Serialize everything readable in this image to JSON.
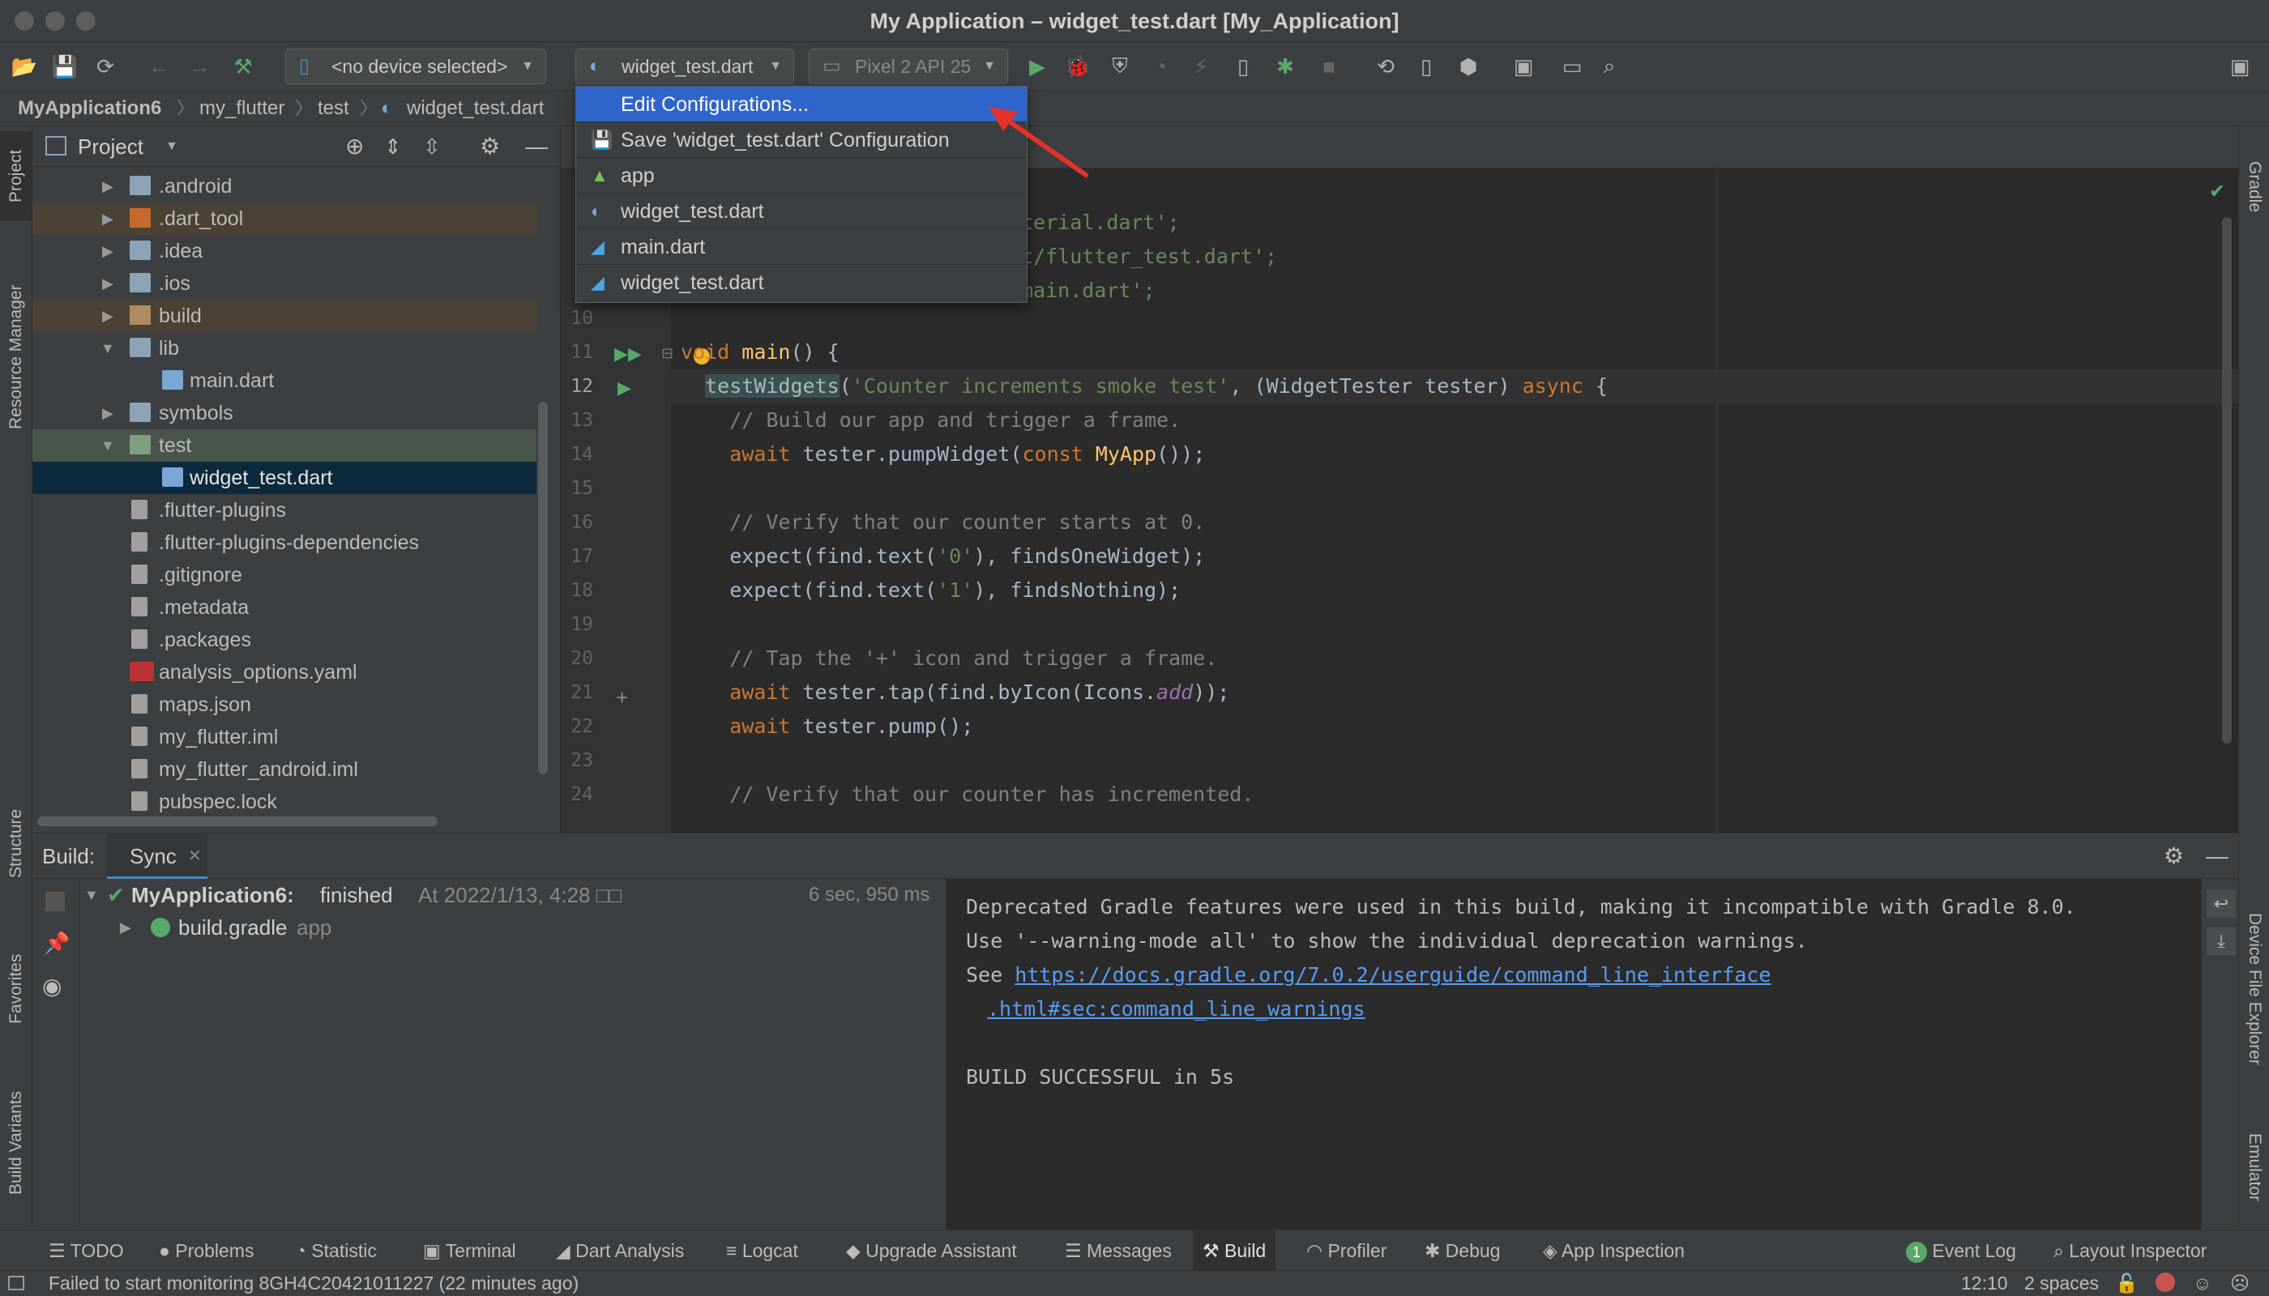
{
  "window": {
    "title": "My Application – widget_test.dart [My_Application]"
  },
  "toolbar": {
    "device_combo": "<no device selected>",
    "config_combo": "widget_test.dart",
    "emulator_combo": "Pixel 2 API 25"
  },
  "breadcrumb": [
    "MyApplication6",
    "my_flutter",
    "test",
    "widget_test.dart"
  ],
  "project_panel": {
    "title": "Project",
    "items": [
      {
        "label": ".android",
        "type": "folder",
        "depth": 1,
        "expanded": false
      },
      {
        "label": ".dart_tool",
        "type": "folder-orange",
        "depth": 1,
        "expanded": false
      },
      {
        "label": ".idea",
        "type": "folder",
        "depth": 1,
        "expanded": false
      },
      {
        "label": ".ios",
        "type": "folder",
        "depth": 1,
        "expanded": false
      },
      {
        "label": "build",
        "type": "folder-orange",
        "depth": 1,
        "expanded": false
      },
      {
        "label": "lib",
        "type": "folder",
        "depth": 1,
        "expanded": true
      },
      {
        "label": "main.dart",
        "type": "dart",
        "depth": 2
      },
      {
        "label": "symbols",
        "type": "folder",
        "depth": 1,
        "expanded": false
      },
      {
        "label": "test",
        "type": "folder-test",
        "depth": 1,
        "expanded": true
      },
      {
        "label": "widget_test.dart",
        "type": "dart",
        "depth": 2,
        "selected": true
      },
      {
        "label": ".flutter-plugins",
        "type": "file",
        "depth": 1
      },
      {
        "label": ".flutter-plugins-dependencies",
        "type": "file",
        "depth": 1
      },
      {
        "label": ".gitignore",
        "type": "file",
        "depth": 1
      },
      {
        "label": ".metadata",
        "type": "file",
        "depth": 1
      },
      {
        "label": ".packages",
        "type": "file",
        "depth": 1
      },
      {
        "label": "analysis_options.yaml",
        "type": "yaml",
        "depth": 1
      },
      {
        "label": "maps.json",
        "type": "file",
        "depth": 1
      },
      {
        "label": "my_flutter.iml",
        "type": "file",
        "depth": 1
      },
      {
        "label": "my_flutter_android.iml",
        "type": "file",
        "depth": 1
      },
      {
        "label": "pubspec.lock",
        "type": "file",
        "depth": 1
      }
    ]
  },
  "config_popup": {
    "items": [
      {
        "label": "Edit Configurations...",
        "icon": "none",
        "highlighted": true
      },
      {
        "label": "Save 'widget_test.dart' Configuration",
        "icon": "save-icon"
      },
      {
        "label": "app",
        "icon": "android-icon"
      },
      {
        "label": "widget_test.dart",
        "icon": "flutter-test-icon"
      },
      {
        "label": "main.dart",
        "icon": "flutter-icon"
      },
      {
        "label": "widget_test.dart",
        "icon": "flutter-icon"
      }
    ]
  },
  "editor": {
    "partial_lines": [
      {
        "text": "terial.dart';"
      },
      {
        "text": "t/flutter_test.dart';"
      },
      {
        "text": "main.dart';"
      }
    ],
    "lines": [
      {
        "num": "10",
        "text": ""
      },
      {
        "num": "11",
        "text": "void main() {"
      },
      {
        "num": "12",
        "text": "  testWidgets('Counter increments smoke test', (WidgetTester tester) async {"
      },
      {
        "num": "13",
        "text": "    // Build our app and trigger a frame."
      },
      {
        "num": "14",
        "text": "    await tester.pumpWidget(const MyApp());"
      },
      {
        "num": "15",
        "text": ""
      },
      {
        "num": "16",
        "text": "    // Verify that our counter starts at 0."
      },
      {
        "num": "17",
        "text": "    expect(find.text('0'), findsOneWidget);"
      },
      {
        "num": "18",
        "text": "    expect(find.text('1'), findsNothing);"
      },
      {
        "num": "19",
        "text": ""
      },
      {
        "num": "20",
        "text": "    // Tap the '+' icon and trigger a frame."
      },
      {
        "num": "21",
        "text": "    await tester.tap(find.byIcon(Icons.add));"
      },
      {
        "num": "22",
        "text": "    await tester.pump();"
      },
      {
        "num": "23",
        "text": ""
      },
      {
        "num": "24",
        "text": "    // Verify that our counter has incremented."
      }
    ]
  },
  "build_panel": {
    "label": "Build:",
    "tab": "Sync",
    "root_name": "MyApplication6:",
    "root_status": "finished",
    "root_time": "At 2022/1/13, 4:28 □□",
    "duration": "6 sec, 950 ms",
    "child_name": "build.gradle",
    "child_suffix": "app",
    "console_line1": "Deprecated Gradle features were used in this build, making it incompatible with Gradle 8.0.",
    "console_line2": "Use '--warning-mode all' to show the individual deprecation warnings.",
    "console_see": "See ",
    "console_link1": "https://docs.gradle.org/7.0.2/userguide/command_line_interface",
    "console_link2": ".html#sec:command_line_warnings",
    "console_success": "BUILD SUCCESSFUL in 5s"
  },
  "left_strip": [
    "Project",
    "Resource Manager",
    "Structure",
    "Favorites",
    "Build Variants"
  ],
  "right_strip": [
    "Gradle",
    "Device File Explorer",
    "Emulator"
  ],
  "tool_tabs": [
    {
      "label": "TODO"
    },
    {
      "label": "Problems"
    },
    {
      "label": "Statistic"
    },
    {
      "label": "Terminal"
    },
    {
      "label": "Dart Analysis"
    },
    {
      "label": "Logcat"
    },
    {
      "label": "Upgrade Assistant"
    },
    {
      "label": "Messages"
    },
    {
      "label": "Build",
      "active": true
    },
    {
      "label": "Profiler"
    },
    {
      "label": "Debug"
    },
    {
      "label": "App Inspection"
    }
  ],
  "right_tool_tabs": {
    "event_log_badge": "1",
    "event_log": "Event Log",
    "layout_inspector": "Layout Inspector"
  },
  "status": {
    "message": "Failed to start monitoring 8GH4C20421011227 (22 minutes ago)",
    "position": "12:10",
    "indent": "2 spaces"
  },
  "colors": {
    "accent": "#2f65ca",
    "arrow": "#e5312b",
    "run_green": "#59a869"
  }
}
